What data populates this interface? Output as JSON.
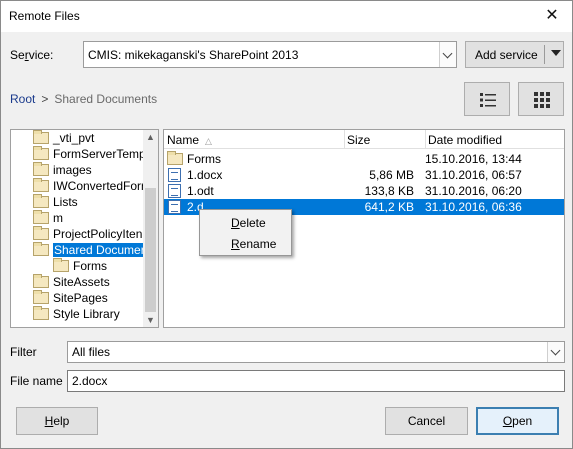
{
  "window": {
    "title": "Remote Files",
    "close_glyph": "✕"
  },
  "service": {
    "label_pre": "Se",
    "label_ul": "r",
    "label_post": "vice:",
    "value": "CMIS: mikekaganski's SharePoint 2013",
    "add_label": "Add service"
  },
  "breadcrumb": {
    "root": "Root",
    "sep": ">",
    "current": "Shared Documents"
  },
  "tree": {
    "items": [
      {
        "label": "_vti_pvt"
      },
      {
        "label": "FormServerTemp"
      },
      {
        "label": "images"
      },
      {
        "label": "IWConvertedForr"
      },
      {
        "label": "Lists"
      },
      {
        "label": "m"
      },
      {
        "label": "ProjectPolicyIten"
      },
      {
        "label": "Shared Documer"
      },
      {
        "label": "Forms"
      },
      {
        "label": "SiteAssets"
      },
      {
        "label": "SitePages"
      },
      {
        "label": "Style Library"
      }
    ]
  },
  "files": {
    "columns": {
      "name": "Name",
      "sort": "△",
      "size": "Size",
      "date": "Date modified"
    },
    "rows": [
      {
        "name": "Forms",
        "size": "",
        "date": "15.10.2016, 13:44",
        "icon": "folder-icon"
      },
      {
        "name": "1.docx",
        "size": "5,86 MB",
        "date": "31.10.2016, 06:57",
        "icon": "document-icon"
      },
      {
        "name": "1.odt",
        "size": "133,8 KB",
        "date": "31.10.2016, 06:20",
        "icon": "document-icon"
      },
      {
        "name": "2.d",
        "size": "641,2 KB",
        "date": "31.10.2016, 06:36",
        "icon": "document-icon"
      }
    ]
  },
  "context_menu": {
    "delete_ul": "D",
    "delete_rest": "elete",
    "rename_ul": "R",
    "rename_rest": "ename"
  },
  "filter": {
    "label": "Filter",
    "value": "All files"
  },
  "filename": {
    "label": "File name",
    "value": "2.docx"
  },
  "buttons": {
    "help_ul": "H",
    "help_rest": "elp",
    "cancel": "Cancel",
    "open_ul": "O",
    "open_rest": "pen"
  },
  "colors": {
    "selection": "#0078d7",
    "root_link": "#1a3a8c"
  }
}
